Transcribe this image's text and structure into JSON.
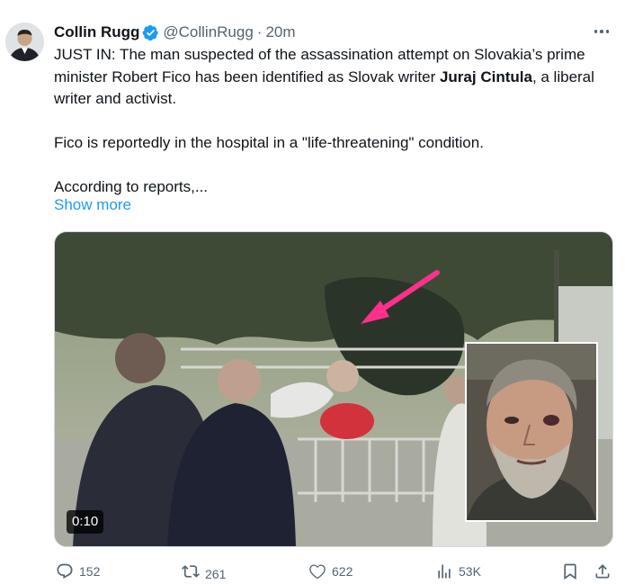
{
  "tweet": {
    "author": {
      "name": "Collin Rugg",
      "handle": "@CollinRugg",
      "separator": "·",
      "time": "20m",
      "verified": true,
      "avatar_icon": "profile-photo"
    },
    "text": {
      "line1_pre": "JUST IN: The man suspected of the assassination attempt on Slovakia’s prime minister Robert Fico has been identified as Slovak writer ",
      "line1_bold": "Juraj Cintula",
      "line1_post": ", a liberal writer and activist.",
      "paragraph2": "Fico is reportedly in the hospital in a \"life-threatening\" condition.",
      "paragraph3": "According to reports,..."
    },
    "show_more": "Show more",
    "media": {
      "duration": "0:10",
      "icon": "video-still"
    },
    "actions": {
      "replies": "152",
      "reposts": "261",
      "likes": "622",
      "views": "53K"
    },
    "colors": {
      "link": "#1d9bf0",
      "secondary_text": "#536471",
      "verified_badge": "#1d9bf0",
      "arrow": "#ff2f8e"
    }
  }
}
